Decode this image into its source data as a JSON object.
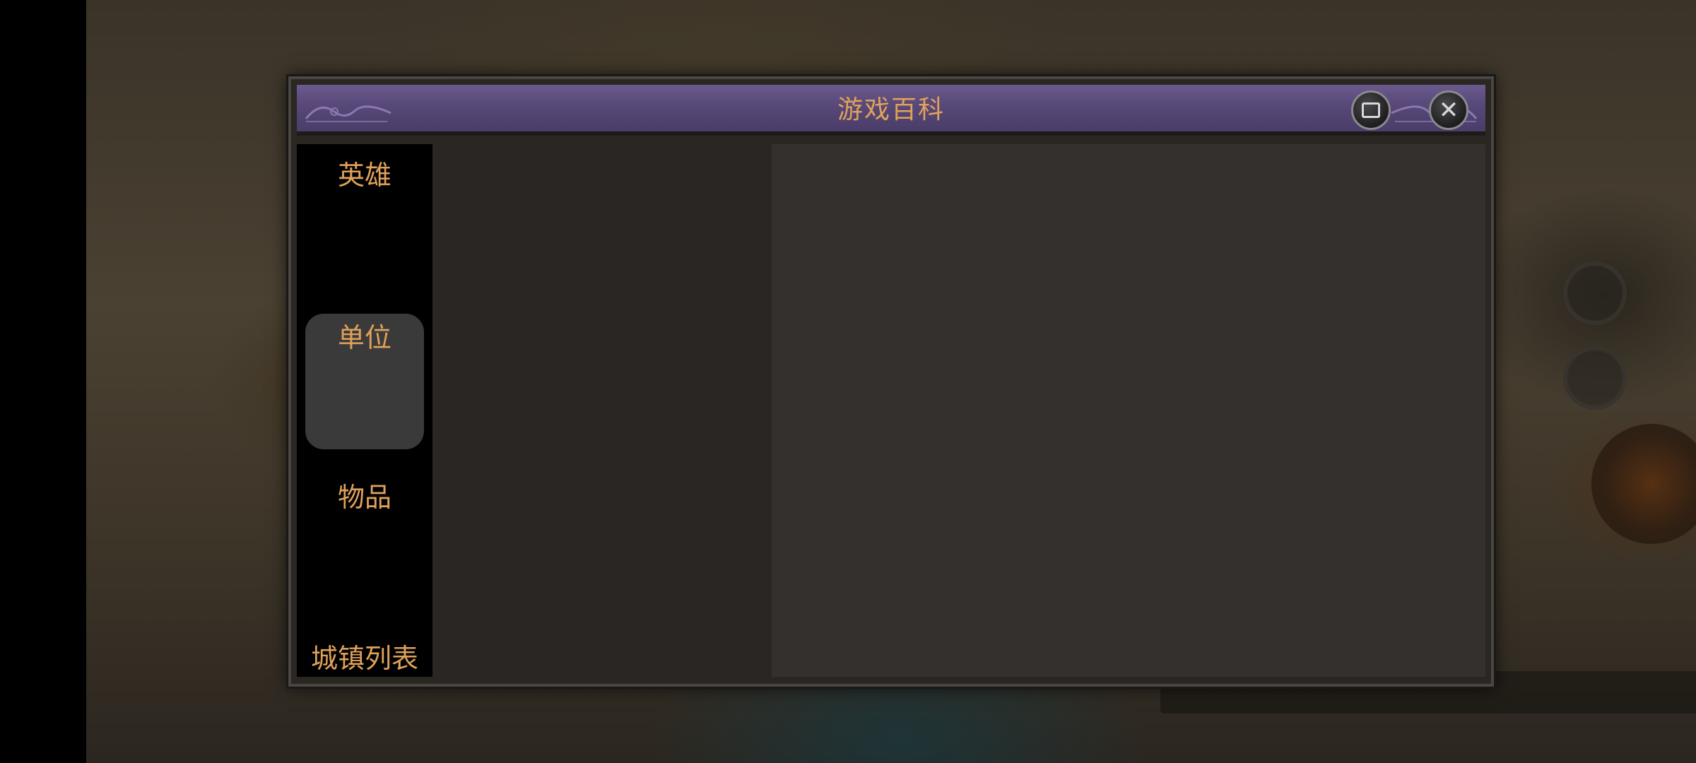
{
  "dialog": {
    "title": "游戏百科",
    "window_button_icon": "window-square-icon",
    "close_button_icon": "close-x-icon",
    "close_glyph": "✕"
  },
  "sidebar": {
    "items": [
      {
        "label": "英雄",
        "active": false
      },
      {
        "label": "单位",
        "active": true
      },
      {
        "label": "物品",
        "active": false
      },
      {
        "label": "城镇列表",
        "active": false
      }
    ]
  },
  "colors": {
    "accent_text": "#e0a15a",
    "title_bar": "#574878",
    "panel": "#2a2622",
    "sidebar": "#000000",
    "active_tab": "#3a3a3a"
  }
}
